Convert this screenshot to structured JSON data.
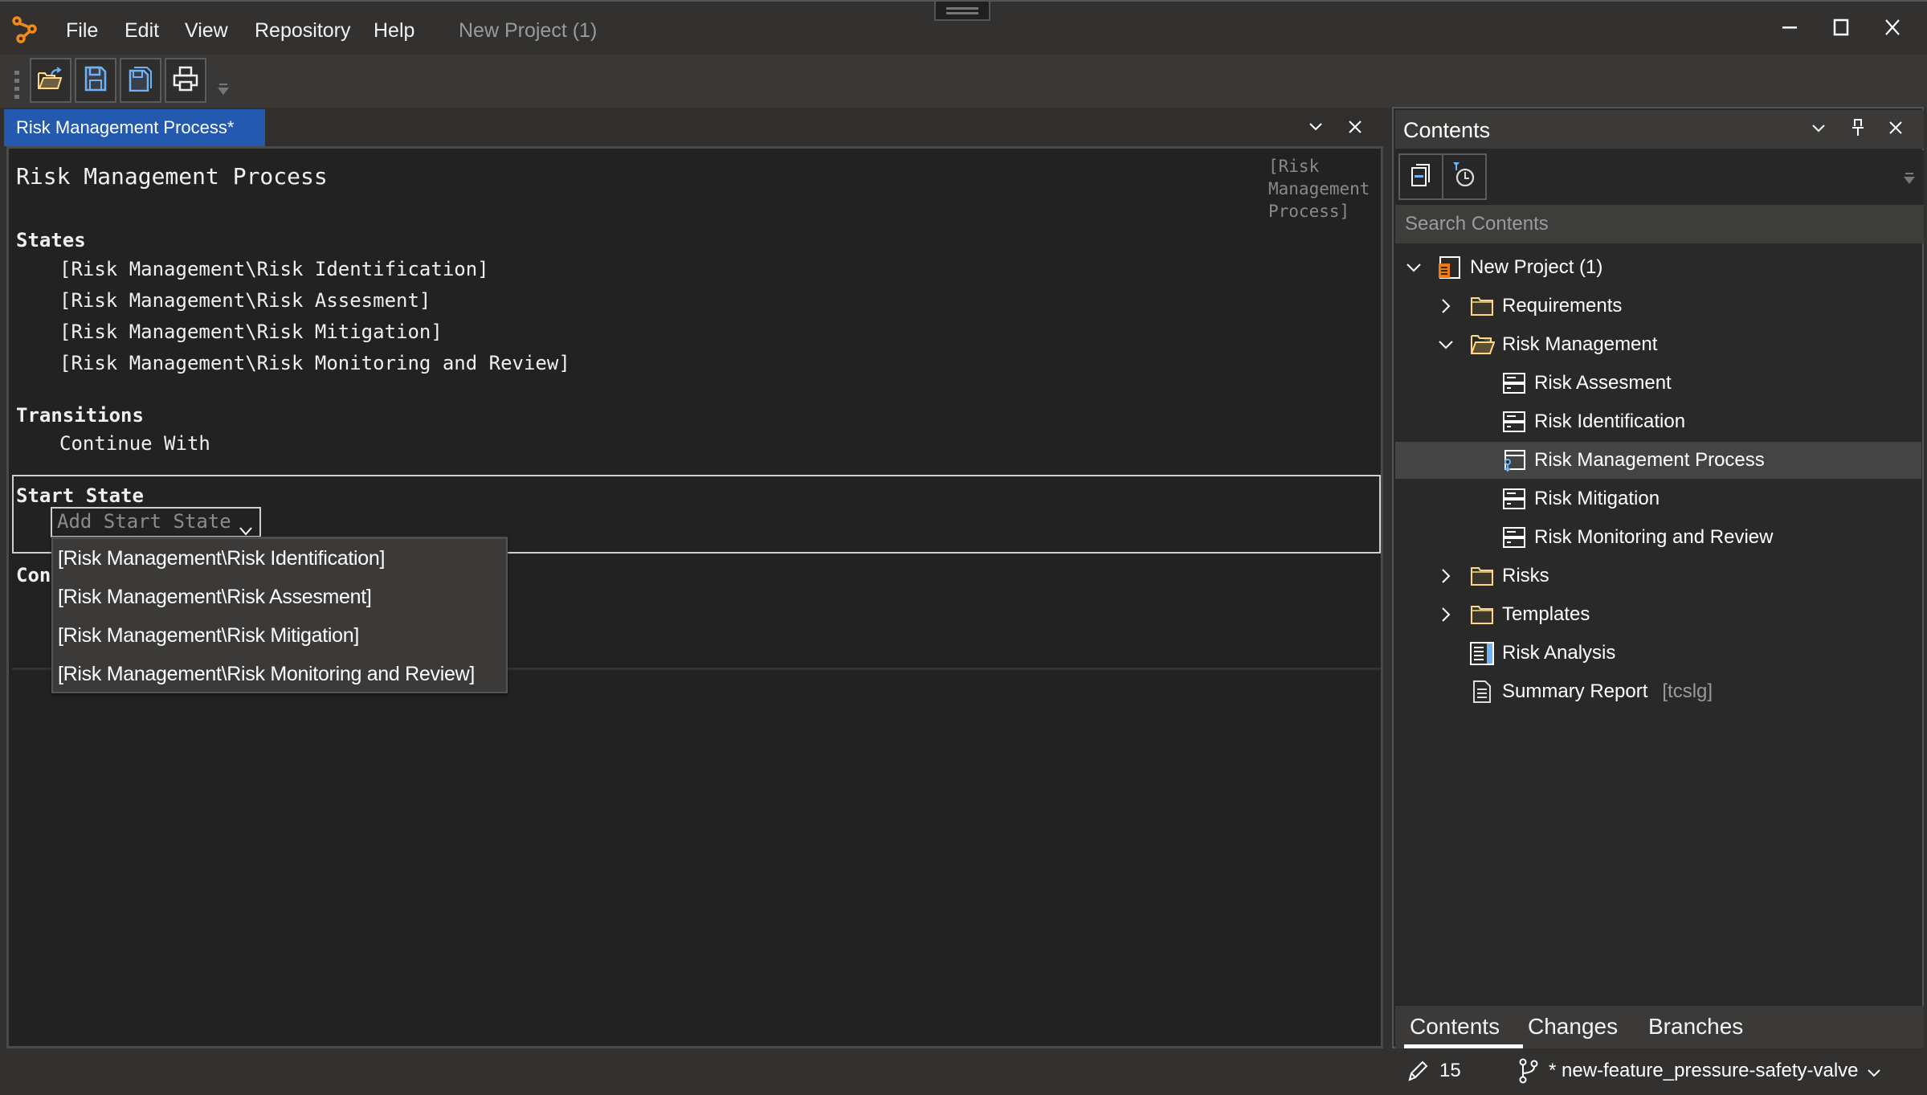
{
  "app": {
    "menu": [
      "File",
      "Edit",
      "View",
      "Repository",
      "Help"
    ],
    "document_title": "New Project (1)",
    "icons": {
      "logo": "app-logo-icon",
      "minimize": "minimize-icon",
      "maximize": "maximize-icon",
      "close": "close-icon"
    }
  },
  "toolbar": {
    "buttons": [
      {
        "name": "open",
        "icon": "open-folder-icon",
        "color": "#ffd88a"
      },
      {
        "name": "save",
        "icon": "save-icon",
        "color": "#6eb3f7"
      },
      {
        "name": "save-all",
        "icon": "save-all-icon",
        "color": "#6eb3f7"
      },
      {
        "name": "print",
        "icon": "print-icon",
        "color": "#f0f0f0"
      }
    ]
  },
  "editor": {
    "tab_label": "Risk Management Process*",
    "tab_color": "#235aaf",
    "title": "Risk Management Process",
    "reference_note": "[Risk\nManagement\nProcess]",
    "states_heading": "States",
    "states": [
      "[Risk Management\\Risk Identification]",
      "[Risk Management\\Risk Assesment]",
      "[Risk Management\\Risk Mitigation]",
      "[Risk Management\\Risk Monitoring and Review]"
    ],
    "transitions_heading": "Transitions",
    "transitions": [
      "Continue With"
    ],
    "start_state_heading": "Start State",
    "start_state_placeholder": "Add Start State",
    "partial_heading": "Con",
    "dropdown_options": [
      "[Risk Management\\Risk Identification]",
      "[Risk Management\\Risk Assesment]",
      "[Risk Management\\Risk Mitigation]",
      "[Risk Management\\Risk Monitoring and Review]"
    ]
  },
  "contents_panel": {
    "title": "Contents",
    "search_placeholder": "Search Contents",
    "tree": [
      {
        "label": "New Project (1)",
        "level": 0,
        "expanded": true,
        "icon": "project-icon"
      },
      {
        "label": "Requirements",
        "level": 1,
        "expanded": false,
        "icon": "folder-icon"
      },
      {
        "label": "Risk Management",
        "level": 1,
        "expanded": true,
        "icon": "folder-open-icon"
      },
      {
        "label": "Risk Assesment",
        "level": 2,
        "icon": "state-icon"
      },
      {
        "label": "Risk Identification",
        "level": 2,
        "icon": "state-icon"
      },
      {
        "label": "Risk Management Process",
        "level": 2,
        "icon": "process-icon",
        "selected": true
      },
      {
        "label": "Risk Mitigation",
        "level": 2,
        "icon": "state-icon"
      },
      {
        "label": "Risk Monitoring and Review",
        "level": 2,
        "icon": "state-icon"
      },
      {
        "label": "Risks",
        "level": 1,
        "expanded": false,
        "icon": "folder-icon"
      },
      {
        "label": "Templates",
        "level": 1,
        "expanded": false,
        "icon": "folder-icon"
      },
      {
        "label": "Risk Analysis",
        "level": 1,
        "icon": "table-view-icon"
      },
      {
        "label": "Summary Report",
        "level": 1,
        "icon": "document-icon",
        "tag": "[tcslg]"
      }
    ],
    "bottom_tabs": [
      "Contents",
      "Changes",
      "Branches"
    ],
    "active_bottom_tab": "Contents"
  },
  "status": {
    "edit_count": "15",
    "branch": "* new-feature_pressure-safety-valve"
  }
}
